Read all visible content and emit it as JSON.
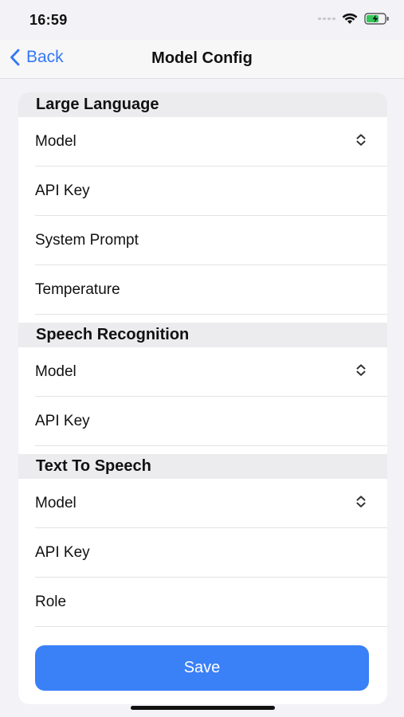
{
  "status_bar": {
    "time": "16:59",
    "icons": [
      "signal-icon",
      "wifi-icon",
      "battery-charging-icon"
    ]
  },
  "nav": {
    "back_label": "Back",
    "title": "Model Config"
  },
  "sections": [
    {
      "header": "Large Language",
      "rows": [
        {
          "label": "Model",
          "picker": true
        },
        {
          "label": "API Key"
        },
        {
          "label": "System Prompt"
        },
        {
          "label": "Temperature"
        }
      ]
    },
    {
      "header": "Speech Recognition",
      "rows": [
        {
          "label": "Model",
          "picker": true
        },
        {
          "label": "API Key"
        }
      ]
    },
    {
      "header": "Text To Speech",
      "rows": [
        {
          "label": "Model",
          "picker": true
        },
        {
          "label": "API Key"
        },
        {
          "label": "Role"
        }
      ]
    }
  ],
  "save_label": "Save",
  "colors": {
    "accent": "#3478f6",
    "button": "#3a80f7",
    "section_bg": "#ececef",
    "page_bg": "#f2f2f7"
  }
}
